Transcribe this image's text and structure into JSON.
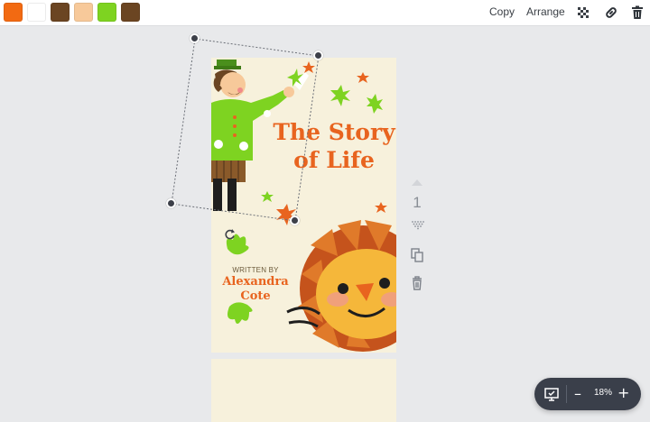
{
  "toolbar": {
    "colors": [
      "#f26a12",
      "#ffffff",
      "#6b4522",
      "#f7c99a",
      "#7ed321",
      "#6b4522"
    ],
    "copy_label": "Copy",
    "arrange_label": "Arrange",
    "icons": [
      "transparency-icon",
      "link-icon",
      "trash-icon"
    ]
  },
  "design": {
    "title": "The Story of Life",
    "written_by": "WRITTEN BY",
    "author": "Alexandra Cote",
    "accent_color": "#e8641f",
    "background_color": "#f7f1dc"
  },
  "side_controls": {
    "page_number": "1",
    "icons": [
      "move-up-icon",
      "move-down-icon",
      "duplicate-page-icon",
      "delete-page-icon"
    ]
  },
  "zoom": {
    "level": "18%",
    "minus": "–",
    "plus": "+"
  }
}
